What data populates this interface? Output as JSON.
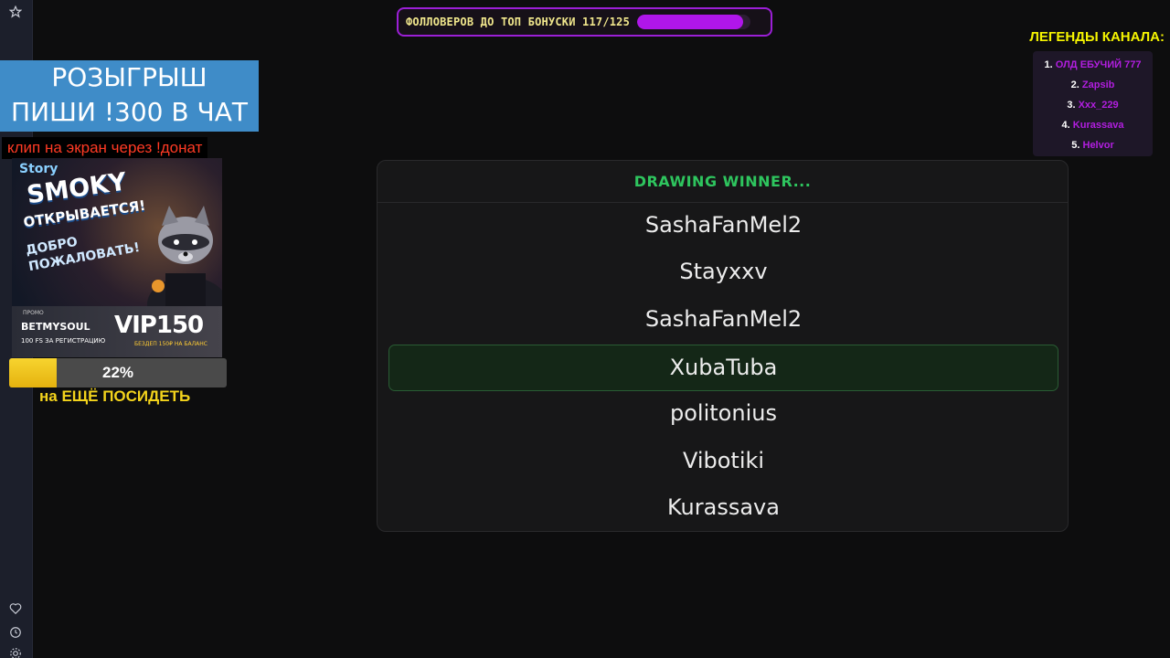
{
  "follower_goal": {
    "text": "ФОЛЛОВЕРОВ ДО ТОП БОНУСКИ 117/125",
    "current": 117,
    "target": 125,
    "bar_color": "#b016ea"
  },
  "legends": {
    "title": "ЛЕГЕНДЫ КАНАЛА:",
    "items": [
      {
        "num": "1.",
        "name": "ОЛД ЕБУЧИЙ 777"
      },
      {
        "num": "2.",
        "name": "Zapsib"
      },
      {
        "num": "3.",
        "name": "Xxx_229"
      },
      {
        "num": "4.",
        "name": "Kurassava"
      },
      {
        "num": "5.",
        "name": "Helvor"
      }
    ]
  },
  "giveaway": {
    "line1": "РОЗЫГРЫШ",
    "line2": "ПИШИ !300 В ЧАТ"
  },
  "clip_note": "клип на экран через !донат",
  "promo_banner": {
    "logo": "Story",
    "title": "SMOKY",
    "subtitle": "ОТКРЫВАЕТСЯ!",
    "welcome": "ДОБРО ПОЖАЛОВАТЬ!",
    "promo_label": "ПРОМО",
    "brand": "BETMYSOUL",
    "free_spins": "100 FS ЗА РЕГИСТРАЦИЮ",
    "code": "VIP150",
    "bonus": "БЕЗДЕП 150₽ НА БАЛАНС"
  },
  "stay_progress": {
    "percent_text": "22%",
    "fraction": 0.22,
    "caption": "на ЕЩЁ ПОСИДЕТЬ"
  },
  "winner_panel": {
    "header": "DRAWING WINNER...",
    "entries": [
      "SashaFanMel2",
      "Stayxxv",
      "SashaFanMel2",
      "XubaTuba",
      "politonius",
      "Vibotiki",
      "Kurassava"
    ],
    "selected_index": 3
  },
  "sidebar_icons": [
    "star-icon",
    "heart-icon",
    "clock-icon",
    "gear-icon"
  ]
}
